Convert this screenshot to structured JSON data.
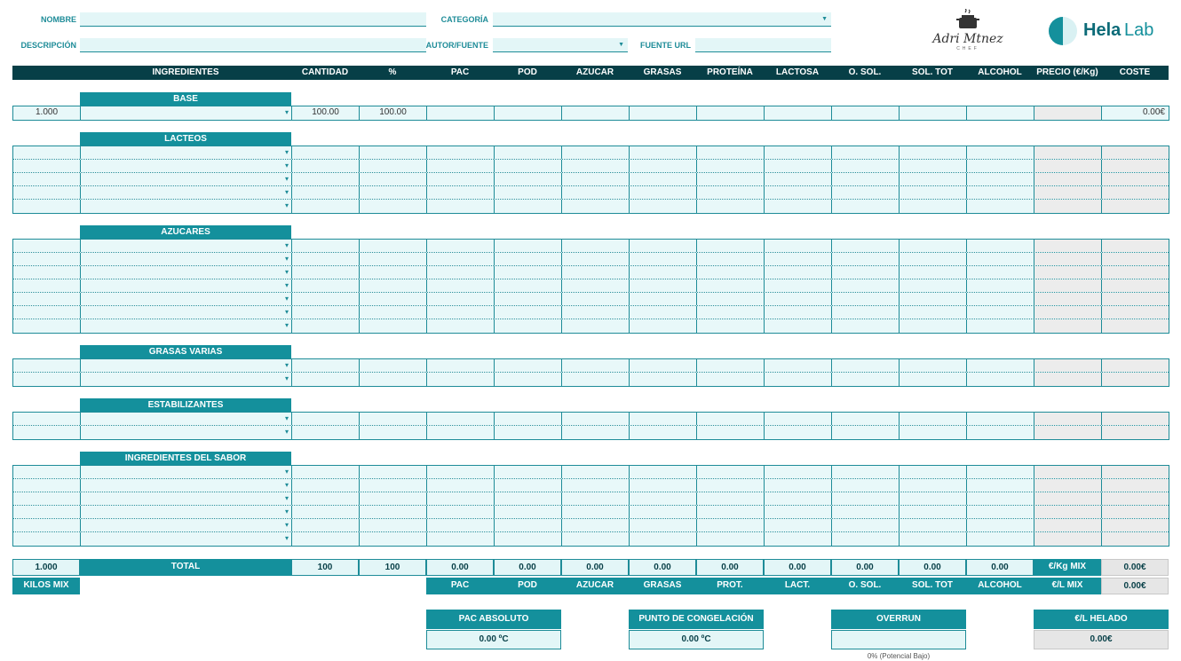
{
  "form": {
    "nombre_label": "NOMBRE",
    "descripcion_label": "DESCRIPCIÓN",
    "categoria_label": "CATEGORÍA",
    "autor_label": "AUTOR/FUENTE",
    "fuente_label": "FUENTE URL",
    "nombre_value": "",
    "descripcion_value": "",
    "categoria_value": "",
    "autor_value": "",
    "fuente_value": ""
  },
  "logos": {
    "chef_script": "Adri Mtnez",
    "chef_sub": "CHEF",
    "brand_bold": "Hela",
    "brand_light": "Lab"
  },
  "columns": [
    "INGREDIENTES",
    "CANTIDAD",
    "%",
    "PAC",
    "POD",
    "AZUCAR",
    "GRASAS",
    "PROTEÍNA",
    "LACTOSA",
    "O. SOL.",
    "SOL. TOT",
    "ALCOHOL",
    "PRECIO (€/Kg)",
    "COSTE"
  ],
  "sections": {
    "base": "BASE",
    "lacteos": "LACTEOS",
    "azucares": "AZUCARES",
    "grasas": "GRASAS VARIAS",
    "estab": "ESTABILIZANTES",
    "sabor": "INGREDIENTES DEL SABOR"
  },
  "base_row": {
    "factor": "1.000",
    "cantidad": "100.00",
    "pct": "100.00",
    "coste": "0.00€"
  },
  "totals": {
    "factor": "1.000",
    "total_label": "TOTAL",
    "cantidad": "100",
    "pct": "100",
    "pac": "0.00",
    "pod": "0.00",
    "azucar": "0.00",
    "grasas": "0.00",
    "prot": "0.00",
    "lact": "0.00",
    "osol": "0.00",
    "soltot": "0.00",
    "alcohol": "0.00",
    "eur_kg_label": "€/Kg MIX",
    "eur_kg_value": "0.00€",
    "kilos_label": "KILOS MIX",
    "eur_l_label": "€/L MIX",
    "eur_l_value": "0.00€",
    "labels": [
      "PAC",
      "POD",
      "AZUCAR",
      "GRASAS",
      "PROT.",
      "LACT.",
      "O. SOL.",
      "SOL. TOT",
      "ALCOHOL"
    ]
  },
  "results": {
    "pac_abs_label": "PAC ABSOLUTO",
    "pac_abs_value": "0.00 ºC",
    "punto_label": "PUNTO DE CONGELACIÓN",
    "punto_value": "0.00 ºC",
    "overrun_label": "OVERRUN",
    "overrun_value": "",
    "overrun_note": "0% (Potencial Bajo)",
    "helado_label": "€/L HELADO",
    "helado_value": "0.00€"
  },
  "colors": {
    "dark": "#073f47",
    "accent": "#14909c",
    "light": "#e3f6f7"
  }
}
